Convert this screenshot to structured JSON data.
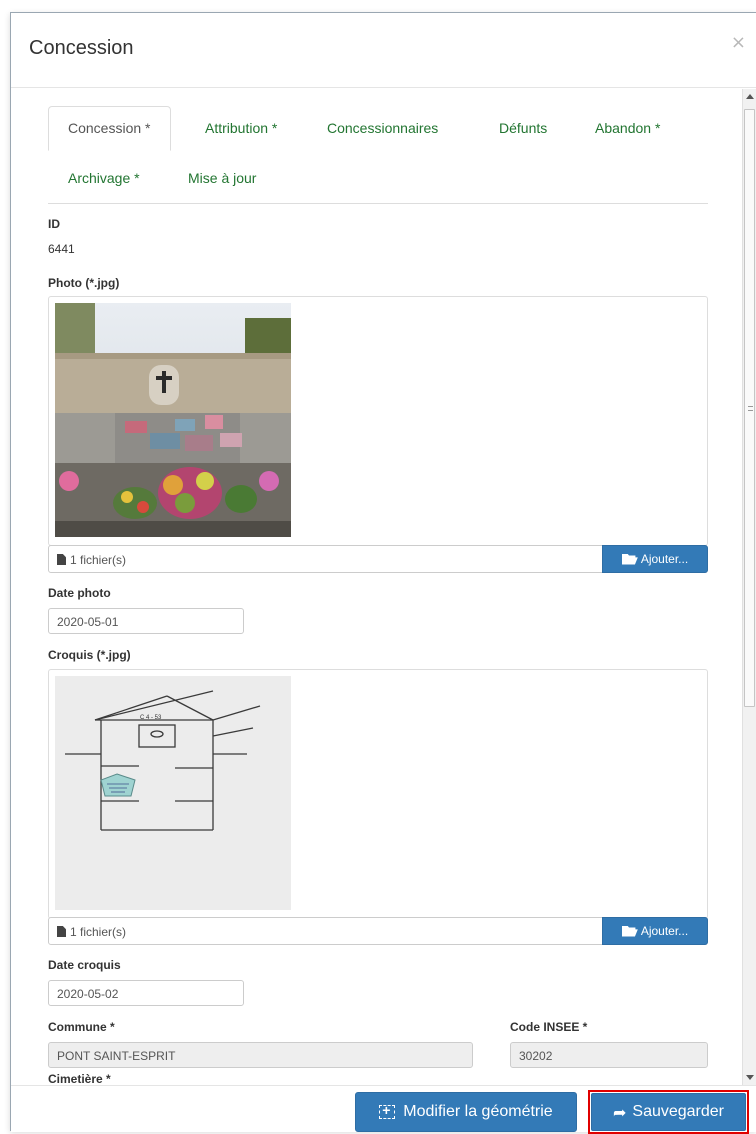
{
  "modal": {
    "title": "Concession",
    "close": "×"
  },
  "tabs": [
    {
      "label": "Concession *"
    },
    {
      "label": "Attribution *"
    },
    {
      "label": "Concessionnaires"
    },
    {
      "label": "Défunts"
    },
    {
      "label": "Abandon *"
    },
    {
      "label": "Archivage *"
    },
    {
      "label": "Mise à jour"
    }
  ],
  "form": {
    "id_label": "ID",
    "id_value": "6441",
    "photo_label": "Photo (*.jpg)",
    "photo_files": "1 fichier(s)",
    "photo_add": "Ajouter...",
    "date_photo_label": "Date photo",
    "date_photo_value": "2020-05-01",
    "croquis_label": "Croquis (*.jpg)",
    "croquis_files": "1 fichier(s)",
    "croquis_add": "Ajouter...",
    "croquis_sketch_code": "C 4 - 53",
    "date_croquis_label": "Date croquis",
    "date_croquis_value": "2020-05-02",
    "commune_label": "Commune *",
    "commune_value": "PONT SAINT-ESPRIT",
    "insee_label": "Code INSEE *",
    "insee_value": "30202",
    "cimetiere_label": "Cimetière *"
  },
  "footer": {
    "modify_geometry": "Modifier la géométrie",
    "save": "Sauvegarder"
  }
}
